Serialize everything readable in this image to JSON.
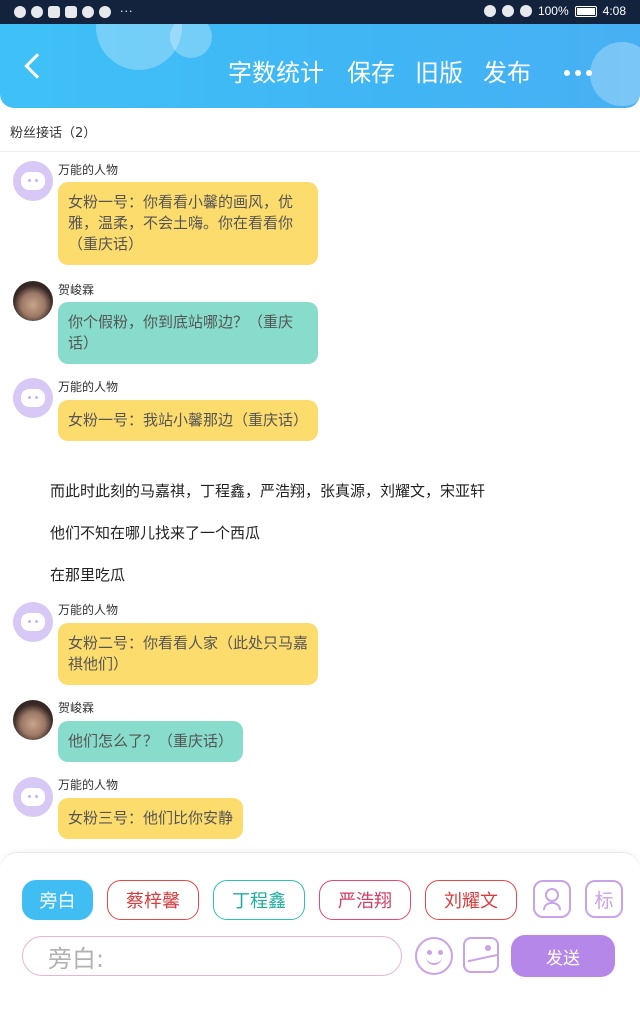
{
  "status_bar": {
    "battery": "100%",
    "time": "4:08",
    "dots": "···"
  },
  "header": {
    "back_icon": "chevron-left-icon",
    "actions": [
      "字数统计",
      "保存",
      "旧版",
      "发布"
    ],
    "more_icon": "more-horizontal-icon",
    "gradient_colors": [
      "#3fc1f7",
      "#47b0f3"
    ]
  },
  "subtitle": "粉丝接话（2）",
  "messages": [
    {
      "type": "bubble",
      "speaker": "万能的人物",
      "avatar": "bot",
      "color": "yellow",
      "text": "女粉一号：你看看小馨的画风，优雅，温柔，不会土嗨。你在看看你（重庆话）"
    },
    {
      "type": "bubble",
      "speaker": "贺峻霖",
      "avatar": "person",
      "color": "teal",
      "text": "你个假粉，你到底站哪边？（重庆话）"
    },
    {
      "type": "bubble",
      "speaker": "万能的人物",
      "avatar": "bot",
      "color": "yellow",
      "text": "女粉一号：我站小馨那边（重庆话）"
    },
    {
      "type": "narration",
      "text": "而此时此刻的马嘉祺，丁程鑫，严浩翔，张真源，刘耀文，宋亚轩"
    },
    {
      "type": "narration",
      "text": "他们不知在哪儿找来了一个西瓜"
    },
    {
      "type": "narration",
      "text": "在那里吃瓜"
    },
    {
      "type": "bubble",
      "speaker": "万能的人物",
      "avatar": "bot",
      "color": "yellow",
      "text": "女粉二号：你看看人家（此处只马嘉祺他们）"
    },
    {
      "type": "bubble",
      "speaker": "贺峻霖",
      "avatar": "person",
      "color": "teal",
      "text": "他们怎么了？（重庆话）"
    },
    {
      "type": "bubble",
      "speaker": "万能的人物",
      "avatar": "bot",
      "color": "yellow",
      "text": "女粉三号：他们比你安静"
    }
  ],
  "composer": {
    "roles": [
      "旁白",
      "蔡梓馨",
      "丁程鑫",
      "严浩翔",
      "刘耀文"
    ],
    "active_role": "旁白",
    "role_icon": "person-icon",
    "tag_label": "标",
    "input_value": "旁白:",
    "emoji_icon": "smiley-icon",
    "image_icon": "image-icon",
    "send_label": "发送",
    "colors": {
      "active": "#40bef4",
      "send": "#b587e8",
      "bubble_yellow": "#fddc6e",
      "bubble_teal": "#88dccc"
    }
  }
}
